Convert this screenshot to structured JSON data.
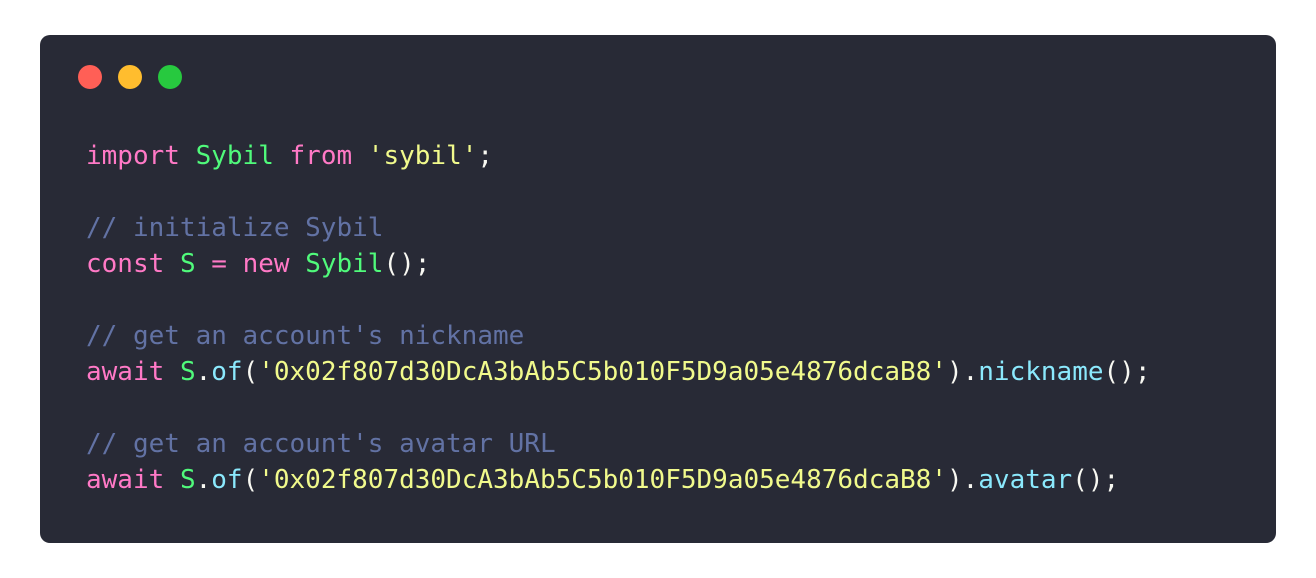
{
  "window": {
    "traffic_lights": [
      {
        "name": "close",
        "color": "#ff5f56"
      },
      {
        "name": "minimize",
        "color": "#ffbd2e"
      },
      {
        "name": "maximize",
        "color": "#27c93f"
      }
    ]
  },
  "code": {
    "line1": {
      "kw_import": "import",
      "cls_sybil": "Sybil",
      "kw_from": "from",
      "str_sybil": "'sybil'",
      "semi": ";"
    },
    "line3": {
      "comment": "// initialize Sybil"
    },
    "line4": {
      "kw_const": "const",
      "var_s": "S",
      "eq": "=",
      "kw_new": "new",
      "cls_sybil": "Sybil",
      "tail": "();"
    },
    "line6": {
      "comment": "// get an account's nickname"
    },
    "line7": {
      "kw_await": "await",
      "var_s": "S",
      "dot1": ".",
      "method_of": "of",
      "open": "(",
      "address": "'0x02f807d30DcA3bAb5C5b010F5D9a05e4876dcaB8'",
      "close_dot": ").",
      "method_nickname": "nickname",
      "tail": "();"
    },
    "line9": {
      "comment": "// get an account's avatar URL"
    },
    "line10": {
      "kw_await": "await",
      "var_s": "S",
      "dot1": ".",
      "method_of": "of",
      "open": "(",
      "address": "'0x02f807d30DcA3bAb5C5b010F5D9a05e4876dcaB8'",
      "close_dot": ").",
      "method_avatar": "avatar",
      "tail": "();"
    }
  }
}
